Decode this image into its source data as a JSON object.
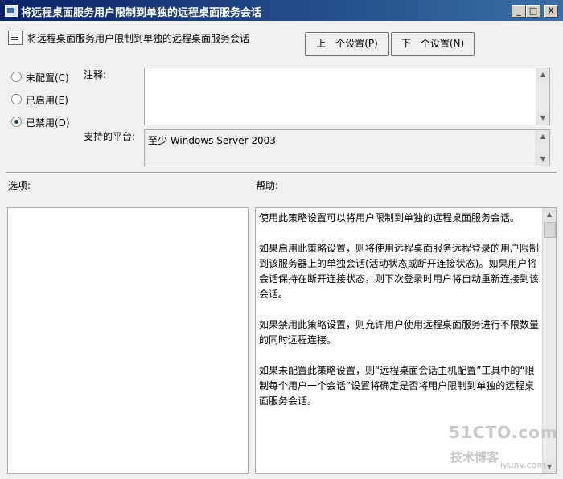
{
  "window": {
    "title": "将远程桌面服务用户限制到单独的远程桌面服务会话",
    "controls": {
      "minimize": "_",
      "maximize": "□",
      "close": "X"
    }
  },
  "header": {
    "setting_name": "将远程桌面服务用户限制到单独的远程桌面服务会话",
    "prev_button": "上一个设置(P)",
    "next_button": "下一个设置(N)"
  },
  "state_options": [
    {
      "label": "未配置(C)",
      "checked": false
    },
    {
      "label": "已启用(E)",
      "checked": false
    },
    {
      "label": "已禁用(D)",
      "checked": true
    }
  ],
  "comment": {
    "label": "注释:",
    "value": ""
  },
  "platform": {
    "label": "支持的平台:",
    "value": "至少 Windows Server 2003"
  },
  "options": {
    "label": "选项:"
  },
  "help": {
    "label": "帮助:",
    "paragraphs": [
      "使用此策略设置可以将用户限制到单独的远程桌面服务会话。",
      "如果启用此策略设置，则将使用远程桌面服务远程登录的用户限制到该服务器上的单独会话(活动状态或断开连接状态)。如果用户将会话保持在断开连接状态，则下次登录时用户将自动重新连接到该会话。",
      "如果禁用此策略设置，则允许用户使用远程桌面服务进行不限数量的同时远程连接。",
      "如果未配置此策略设置，则“远程桌面会话主机配置”工具中的“限制每个用户一个会话”设置将确定是否将用户限制到单独的远程桌面服务会话。"
    ]
  },
  "watermark": {
    "line1": "51CTO.com",
    "line2": "技术博客",
    "line3": "iyunv.com"
  },
  "colors": {
    "titlebar": "#0a246a",
    "window_bg": "#f0f0f0"
  },
  "icons": {
    "app": "app-icon",
    "setting": "setting-icon"
  }
}
